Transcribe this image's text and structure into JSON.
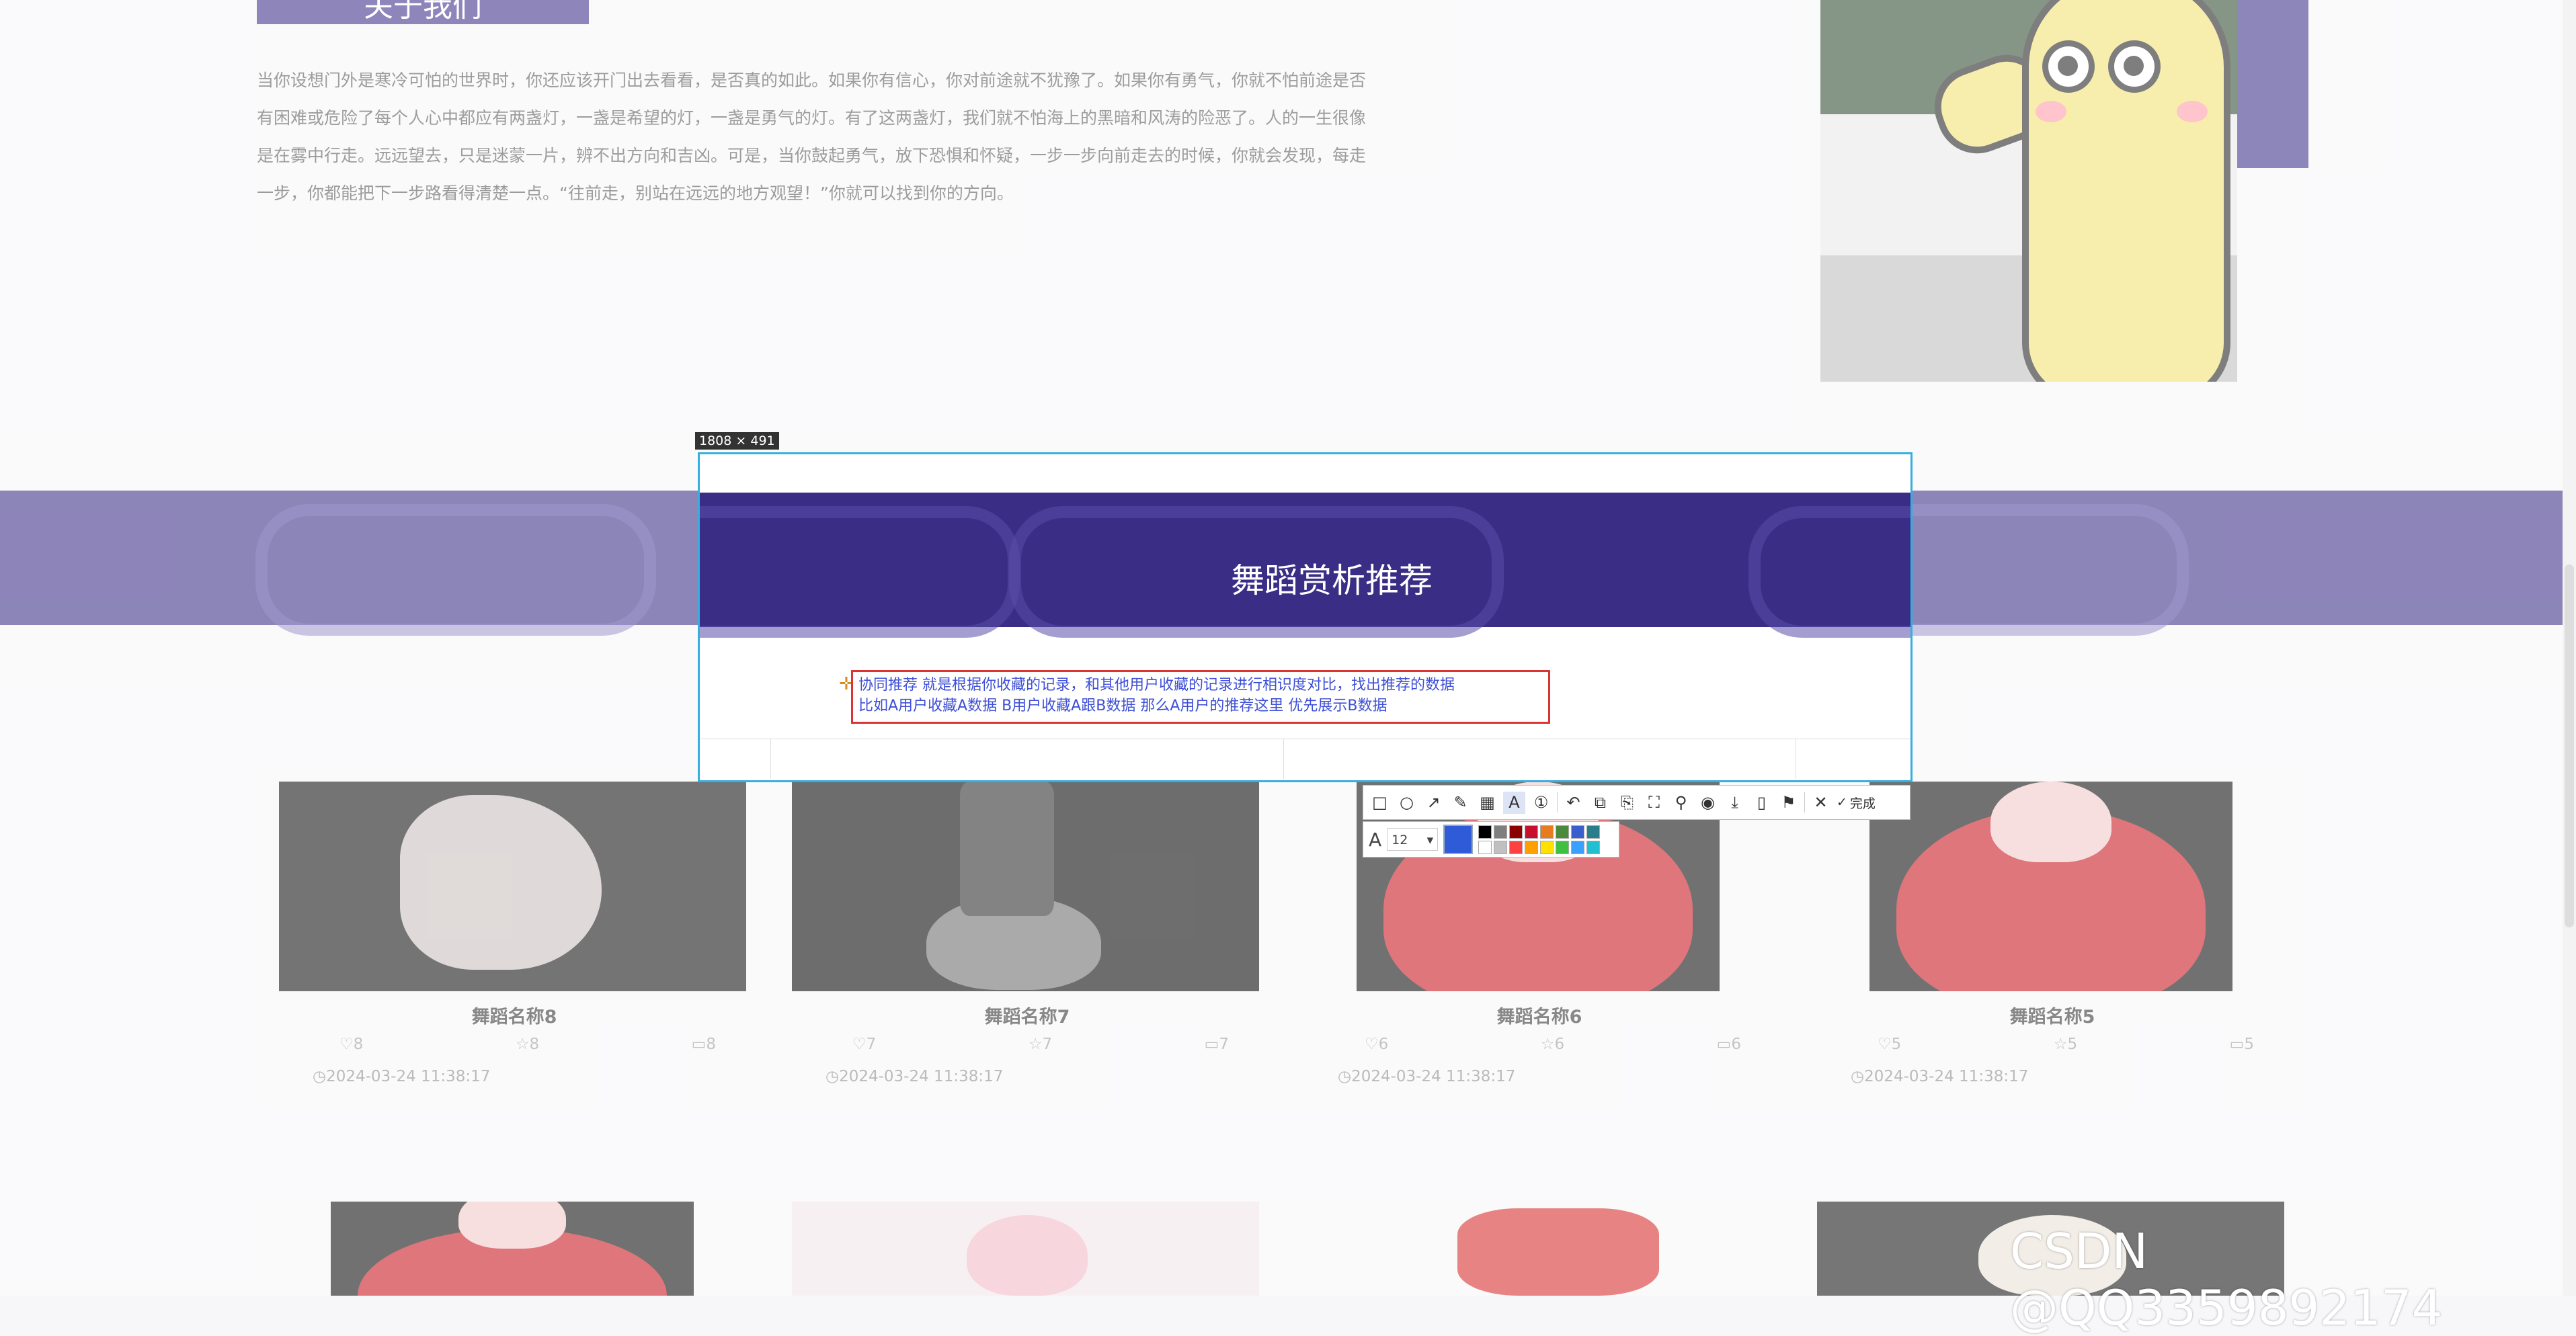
{
  "page": {
    "about_button": "关于我们",
    "about_text": "当你设想门外是寒冷可怕的世界时，你还应该开门出去看看，是否真的如此。如果你有信心，你对前途就不犹豫了。如果你有勇气，你就不怕前途是否有困难或危险了每个人心中都应有两盏灯，一盏是希望的灯，一盏是勇气的灯。有了这两盏灯，我们就不怕海上的黑暗和风涛的险恶了。人的一生很像是在雾中行走。远远望去，只是迷蒙一片，辨不出方向和吉凶。可是，当你鼓起勇气，放下恐惧和怀疑，一步一步向前走去的时候，你就会发现，每走一步，你都能把下一步路看得清楚一点。“往前走，别站在远远的地方观望！”你就可以找到你的方向。",
    "banner_title": "舞蹈赏析推荐"
  },
  "capture": {
    "size_label": "1808 × 491",
    "annotation_line1": "协同推荐 就是根据你收藏的记录，和其他用户收藏的记录进行相识度对比，找出推荐的数据",
    "annotation_line2": "比如A用户收藏A数据 B用户收藏A跟B数据 那么A用户的推荐这里 优先展示B数据"
  },
  "toolbar": {
    "tools": [
      {
        "icon": "rectangle-icon",
        "glyph": "□"
      },
      {
        "icon": "ellipse-icon",
        "glyph": "○"
      },
      {
        "icon": "arrow-icon",
        "glyph": "↗"
      },
      {
        "icon": "pen-icon",
        "glyph": "✎"
      },
      {
        "icon": "mosaic-icon",
        "glyph": "▦"
      },
      {
        "icon": "text-icon",
        "glyph": "A"
      },
      {
        "icon": "number-icon",
        "glyph": "①"
      },
      {
        "icon": "undo-icon",
        "glyph": "↶"
      },
      {
        "icon": "redo-icon",
        "glyph": "⧉"
      },
      {
        "icon": "copy-icon",
        "glyph": "⎘"
      },
      {
        "icon": "scroll-capture-icon",
        "glyph": "⛶"
      },
      {
        "icon": "pin-icon",
        "glyph": "📌"
      },
      {
        "icon": "record-icon",
        "glyph": "◉"
      },
      {
        "icon": "download-icon",
        "glyph": "⤓"
      },
      {
        "icon": "long-screenshot-icon",
        "glyph": "▯"
      },
      {
        "icon": "bookmark-icon",
        "glyph": "🔖"
      },
      {
        "icon": "close-icon",
        "glyph": "✕"
      }
    ],
    "done_label": "完成",
    "font_size": "12",
    "colors": [
      "#000000",
      "#7f7f7f",
      "#8b0000",
      "#c8102e",
      "#e87b1e",
      "#4a8a3a",
      "#3a5fcd",
      "#2a7d8a",
      "#ffffff",
      "#c0c0c0",
      "#ff4040",
      "#ff9f00",
      "#ffe000",
      "#40c040",
      "#3aa0ff",
      "#20c0d0"
    ],
    "current_color": "#2f5bd8"
  },
  "cards": [
    {
      "name": "舞蹈名称8",
      "likes": "8",
      "favorites": "8",
      "comments": "8",
      "date": "2024-03-24 11:38:17"
    },
    {
      "name": "舞蹈名称7",
      "likes": "7",
      "favorites": "7",
      "comments": "7",
      "date": "2024-03-24 11:38:17"
    },
    {
      "name": "舞蹈名称6",
      "likes": "6",
      "favorites": "6",
      "comments": "6",
      "date": "2024-03-24 11:38:17"
    },
    {
      "name": "舞蹈名称5",
      "likes": "5",
      "favorites": "5",
      "comments": "5",
      "date": "2024-03-24 11:38:17"
    }
  ],
  "watermark": "CSDN @QQ3359892174"
}
